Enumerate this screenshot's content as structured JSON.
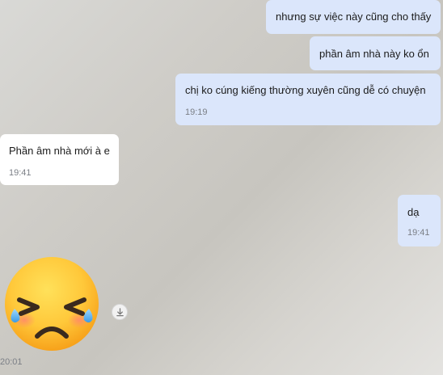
{
  "messages": [
    {
      "text": "nhưng sự việc này cũng cho thấy",
      "time": ""
    },
    {
      "text": "phần âm nhà này ko ổn",
      "time": ""
    },
    {
      "text": "chị ko cúng kiếng thường xuyên cũng dễ có chuyện",
      "time": "19:19"
    },
    {
      "text": "Phần âm nhà mới à e",
      "time": "19:41"
    },
    {
      "text": "dạ",
      "time": "19:41"
    }
  ],
  "sticker": {
    "icon": "crying-face-emoji-icon",
    "time": "20:01"
  },
  "colors": {
    "sent_bubble": "#dbe6fb",
    "received_bubble": "#ffffff",
    "timestamp": "#7b7f86"
  }
}
